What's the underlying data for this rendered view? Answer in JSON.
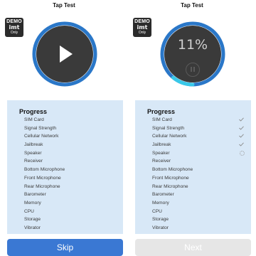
{
  "screens": [
    {
      "title": "Tap Test",
      "badge": {
        "line1": "DEMO",
        "line2": "imt",
        "line3": "Only"
      },
      "progress_title": "Progress",
      "items": [
        {
          "label": "SIM Card",
          "status": ""
        },
        {
          "label": "Signal Strength",
          "status": ""
        },
        {
          "label": "Cellular Network",
          "status": ""
        },
        {
          "label": "Jailbreak",
          "status": ""
        },
        {
          "label": "Speaker",
          "status": ""
        },
        {
          "label": "Receiver",
          "status": ""
        },
        {
          "label": "Bottom Microphone",
          "status": ""
        },
        {
          "label": "Front Microphone",
          "status": ""
        },
        {
          "label": "Rear Microphone",
          "status": ""
        },
        {
          "label": "Barometer",
          "status": ""
        },
        {
          "label": "Memory",
          "status": ""
        },
        {
          "label": "CPU",
          "status": ""
        },
        {
          "label": "Storage",
          "status": ""
        },
        {
          "label": "Vibrator",
          "status": ""
        }
      ],
      "button_label": "Skip",
      "button_enabled": true
    },
    {
      "title": "Tap Test",
      "badge": {
        "line1": "DEMO",
        "line2": "imt",
        "line3": "Only"
      },
      "percent_text": "11%",
      "progress_fraction": 0.11,
      "progress_title": "Progress",
      "items": [
        {
          "label": "SIM Card",
          "status": "done"
        },
        {
          "label": "Signal Strength",
          "status": "done"
        },
        {
          "label": "Cellular Network",
          "status": "done"
        },
        {
          "label": "Jailbreak",
          "status": "done"
        },
        {
          "label": "Speaker",
          "status": "running"
        },
        {
          "label": "Receiver",
          "status": ""
        },
        {
          "label": "Bottom Microphone",
          "status": ""
        },
        {
          "label": "Front Microphone",
          "status": ""
        },
        {
          "label": "Rear Microphone",
          "status": ""
        },
        {
          "label": "Barometer",
          "status": ""
        },
        {
          "label": "Memory",
          "status": ""
        },
        {
          "label": "CPU",
          "status": ""
        },
        {
          "label": "Storage",
          "status": ""
        },
        {
          "label": "Vibrator",
          "status": ""
        }
      ],
      "button_label": "Next",
      "button_enabled": false
    }
  ],
  "colors": {
    "ring": "#2a77c8",
    "progress_arc": "#38c8e8",
    "circle_fill": "#3a3a3a",
    "panel_bg": "#d8e8f7",
    "primary_button": "#3a78d3",
    "disabled_button": "#e6e6e6"
  },
  "icons": {
    "play": "play-icon",
    "pause": "pause-icon",
    "check": "checkmark-icon",
    "spinner": "loading-spinner-icon"
  }
}
